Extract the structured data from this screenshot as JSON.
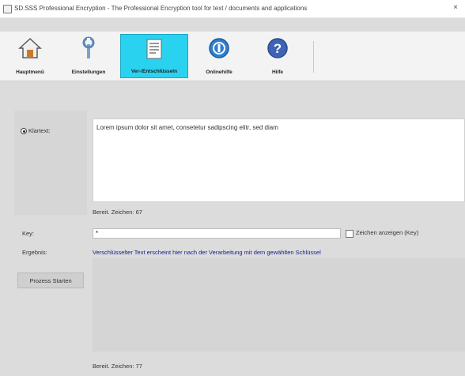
{
  "window": {
    "title": "SD.SSS Professional Encryption - The Professional Encryption tool for text / documents and applications",
    "close_glyph": "×"
  },
  "toolbar": {
    "buttons": [
      {
        "label": "Hauptmenü",
        "icon": "home-icon",
        "active": false
      },
      {
        "label": "Einstellungen",
        "icon": "tools-icon",
        "active": false
      },
      {
        "label": "Ver-/Entschlüsseln",
        "icon": "document-icon",
        "active": true
      },
      {
        "label": "Onlinehilfe",
        "icon": "info-icon",
        "active": false
      },
      {
        "label": "Hilfe",
        "icon": "help-icon",
        "active": false
      }
    ]
  },
  "form": {
    "text_radio_label": "Klartext:",
    "content_text": "Lorem ipsum dolor sit amet, consetetur sadipscing elitr, sed diam",
    "info_top": "Bereit. Zeichen: 67",
    "key_label": "Key:",
    "key_value": "*",
    "checkbox_label": "Zeichen anzeigen (Key)",
    "result_label": "Ergebnis:",
    "result_text": "Verschlüsselter Text erscheint hier nach der Verarbeitung mit dem gewählten Schlüssel",
    "process_button": "Prozess Starten",
    "info_bottom": "Bereit. Zeichen: 77"
  },
  "colors": {
    "accent": "#29d3ef",
    "result_text": "#1a1a8c"
  }
}
